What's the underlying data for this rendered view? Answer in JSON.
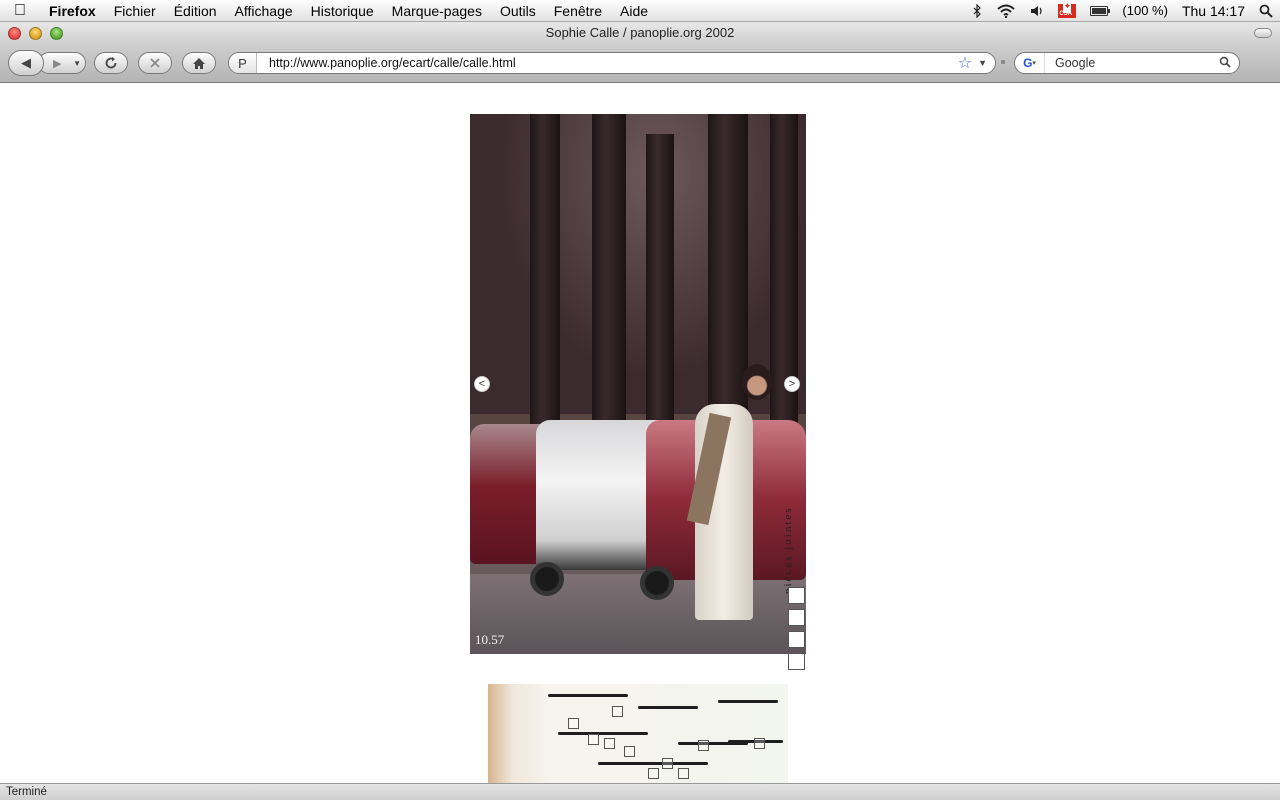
{
  "menubar": {
    "app_name": "Firefox",
    "items": [
      "Fichier",
      "Édition",
      "Affichage",
      "Historique",
      "Marque-pages",
      "Outils",
      "Fenêtre",
      "Aide"
    ],
    "battery_text": "(100 %)",
    "battery_level": 1.0,
    "flag_label": "CSA",
    "clock": "Thu 14:17"
  },
  "window": {
    "title": "Sophie Calle / panoplie.org 2002"
  },
  "toolbar": {
    "url": "http://www.panoplie.org/ecart/calle/calle.html",
    "search_placeholder": "Google",
    "site_icon": "P"
  },
  "page": {
    "timestamp": "10.57",
    "pieces_label": "pieces jointes",
    "prev_arrow": "<",
    "next_arrow": ">",
    "attachments_count": 4
  },
  "statusbar": {
    "text": "Terminé"
  },
  "colors": {
    "link_star": "#3e6ed2",
    "close": "#e0443e",
    "minimize": "#dea123",
    "maximize": "#5aa832"
  },
  "icons": [
    "apple-icon",
    "bluetooth-icon",
    "wifi-icon",
    "volume-icon",
    "canada-flag-icon",
    "battery-icon",
    "spotlight-icon",
    "back-icon",
    "forward-icon",
    "reload-icon",
    "stop-icon",
    "home-icon",
    "bookmark-star-icon",
    "google-icon",
    "search-icon"
  ]
}
